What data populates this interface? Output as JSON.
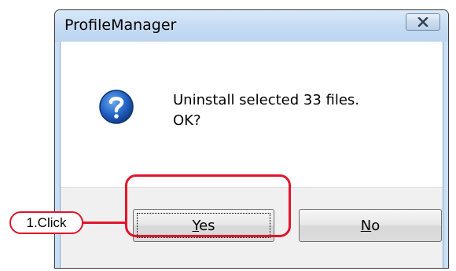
{
  "dialog": {
    "title": "ProfileManager",
    "message_line1": "Uninstall selected 33 files.",
    "message_line2": "OK?",
    "icon": "question-icon",
    "close_icon": "close-icon"
  },
  "buttons": {
    "yes_label": "Yes",
    "no_label": "No"
  },
  "annotation": {
    "callout_label": "1.Click",
    "color": "#e0162b"
  },
  "colors": {
    "titlebar": "#c5dbf3",
    "question_icon": "#1f5fbf"
  }
}
